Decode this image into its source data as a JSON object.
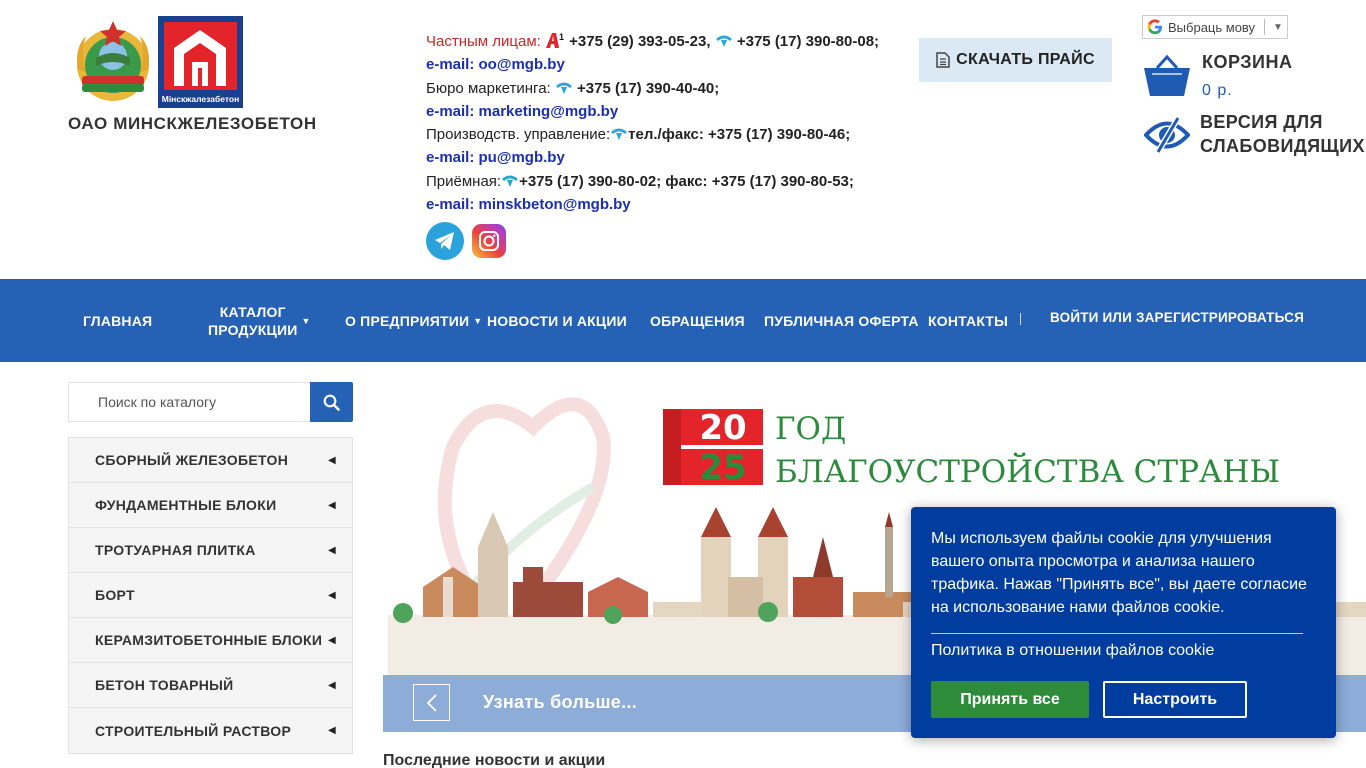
{
  "header": {
    "company_name": "ОАО МИНСКЖЕЛЕЗОБЕТОН",
    "mgb_logo_text": "Мінскжалезабетон"
  },
  "contacts": {
    "private_label": "Частным лицам:",
    "private_phone1": "+375 (29) 393-05-23,",
    "private_phone2": "+375 (17) 390-80-08;",
    "email1": "e-mail: oo@mgb.by",
    "marketing_label": "Бюро маркетинга:",
    "marketing_phone": "+375 (17) 390-40-40;",
    "email2": "e-mail: marketing@mgb.by",
    "production_label": "Производств. управление:",
    "production_phone": "тел./факс: +375 (17) 390-80-46;",
    "email3": "e-mail: pu@mgb.by",
    "reception_label": "Приёмная:",
    "reception_phone": "+375 (17) 390-80-02; факс: +375 (17) 390-80-53;",
    "email4": "e-mail: minskbeton@mgb.by"
  },
  "price_button": "СКАЧАТЬ ПРАЙС",
  "language": {
    "label": "Выбраць мову",
    "caret": "▼"
  },
  "cart": {
    "title": "КОРЗИНА",
    "sum": "0 р."
  },
  "vision": {
    "line1": "ВЕРСИЯ ДЛЯ",
    "line2": "СЛАБОВИДЯЩИХ"
  },
  "nav": {
    "home": "ГЛАВНАЯ",
    "catalog_l1": "КАТАЛОГ",
    "catalog_l2": "ПРОДУКЦИИ",
    "about": "О ПРЕДПРИЯТИИ",
    "news": "НОВОСТИ И АКЦИИ",
    "appeals": "ОБРАЩЕНИЯ",
    "offer": "ПУБЛИЧНАЯ ОФЕРТА",
    "contacts": "КОНТАКТЫ",
    "login": "ВОЙТИ ИЛИ ЗАРЕГИСТРИРОВАТЬСЯ"
  },
  "search": {
    "placeholder": "Поиск по каталогу"
  },
  "catalog": {
    "items": [
      "СБОРНЫЙ ЖЕЛЕЗОБЕТОН",
      "ФУНДАМЕНТНЫЕ БЛОКИ",
      "ТРОТУАРНАЯ ПЛИТКА",
      "БОРТ",
      "КЕРАМЗИТОБЕТОННЫЕ БЛОКИ",
      "БЕТОН ТОВАРНЫЙ",
      "СТРОИТЕЛЬНЫЙ РАСТВОР"
    ]
  },
  "banner": {
    "year_top": "20",
    "year_bottom": "25",
    "title_line1": "ГОД",
    "title_line2": "БЛАГОУСТРОЙСТВА СТРАНЫ",
    "more_link": "Узнать больше..."
  },
  "news_title": "Последние новости и акции",
  "cookie": {
    "text": "Мы используем файлы cookie для улучшения вашего опыта просмотра и анализа нашего трафика. Нажав \"Принять все\", вы даете согласие на использование нами файлов cookie.",
    "policy_link": "Политика в отношении файлов cookie",
    "accept": "Принять все",
    "settings": "Настроить"
  },
  "colors": {
    "nav_bg": "#2561b5",
    "cookie_bg": "#003d9e",
    "accept_green": "#2d8b39",
    "email_blue": "#1a2fb3",
    "banner_red": "#e3242b",
    "banner_green": "#2c8a3c"
  }
}
